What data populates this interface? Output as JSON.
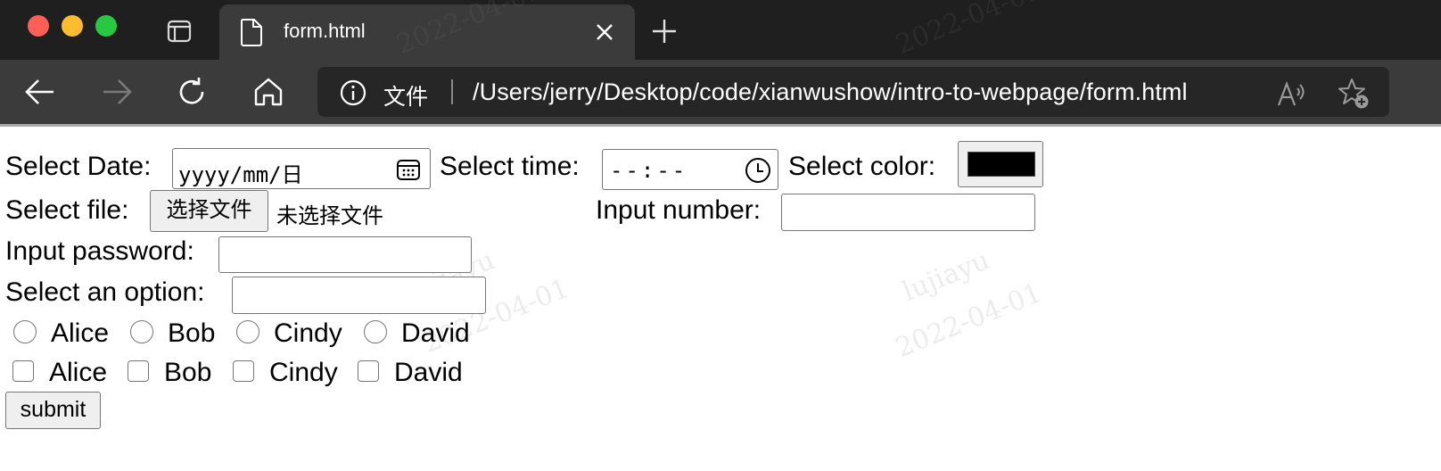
{
  "browser": {
    "tab_title": "form.html",
    "address": {
      "security_label": "文件",
      "url": "/Users/jerry/Desktop/code/xianwushow/intro-to-webpage/form.html"
    }
  },
  "form": {
    "date": {
      "label": "Select Date:",
      "placeholder": "yyyy/mm/日"
    },
    "time": {
      "label": "Select time:",
      "placeholder": "--:--"
    },
    "color": {
      "label": "Select color:",
      "value": "#000000"
    },
    "file": {
      "label": "Select file:",
      "button": "选择文件",
      "status": "未选择文件"
    },
    "number": {
      "label": "Input number:",
      "value": ""
    },
    "password": {
      "label": "Input password:",
      "value": ""
    },
    "select": {
      "label": "Select an option:",
      "value": ""
    },
    "radios": [
      "Alice",
      "Bob",
      "Cindy",
      "David"
    ],
    "checkboxes": [
      "Alice",
      "Bob",
      "Cindy",
      "David"
    ],
    "submit_label": "submit"
  },
  "watermarks": [
    {
      "name": "lujiayu",
      "date": "2022-04-01"
    }
  ]
}
